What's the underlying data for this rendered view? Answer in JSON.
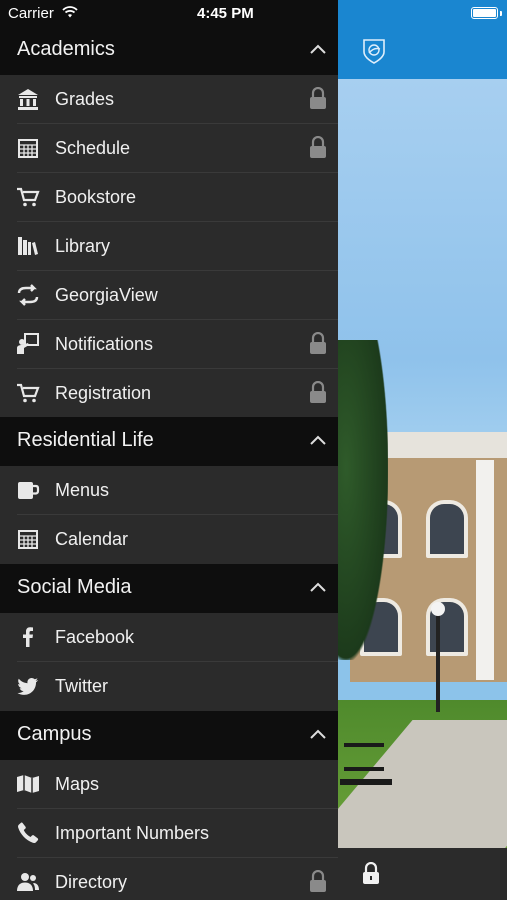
{
  "status_bar": {
    "carrier": "Carrier",
    "time": "4:45 PM"
  },
  "sections": [
    {
      "title": "Academics",
      "items": [
        {
          "label": "Grades",
          "icon": "bank-icon",
          "locked": true
        },
        {
          "label": "Schedule",
          "icon": "calendar-grid-icon",
          "locked": true
        },
        {
          "label": "Bookstore",
          "icon": "cart-icon",
          "locked": false
        },
        {
          "label": "Library",
          "icon": "books-icon",
          "locked": false
        },
        {
          "label": "GeorgiaView",
          "icon": "sync-arrows-icon",
          "locked": false
        },
        {
          "label": "Notifications",
          "icon": "presenter-icon",
          "locked": true
        },
        {
          "label": "Registration",
          "icon": "cart-icon",
          "locked": true
        }
      ]
    },
    {
      "title": "Residential Life",
      "items": [
        {
          "label": "Menus",
          "icon": "mug-icon",
          "locked": false
        },
        {
          "label": "Calendar",
          "icon": "calendar-grid-icon",
          "locked": false
        }
      ]
    },
    {
      "title": "Social Media",
      "items": [
        {
          "label": "Facebook",
          "icon": "facebook-icon",
          "locked": false
        },
        {
          "label": "Twitter",
          "icon": "twitter-icon",
          "locked": false
        }
      ]
    },
    {
      "title": "Campus",
      "items": [
        {
          "label": "Maps",
          "icon": "map-icon",
          "locked": false
        },
        {
          "label": "Important Numbers",
          "icon": "phone-icon",
          "locked": false
        },
        {
          "label": "Directory",
          "icon": "people-icon",
          "locked": true
        }
      ]
    }
  ],
  "colors": {
    "menu_bg": "#2b2b2b",
    "header_bg": "#0e0e0e",
    "accent_blue": "#1a86d0",
    "lock_gray": "#8a8a8a"
  }
}
